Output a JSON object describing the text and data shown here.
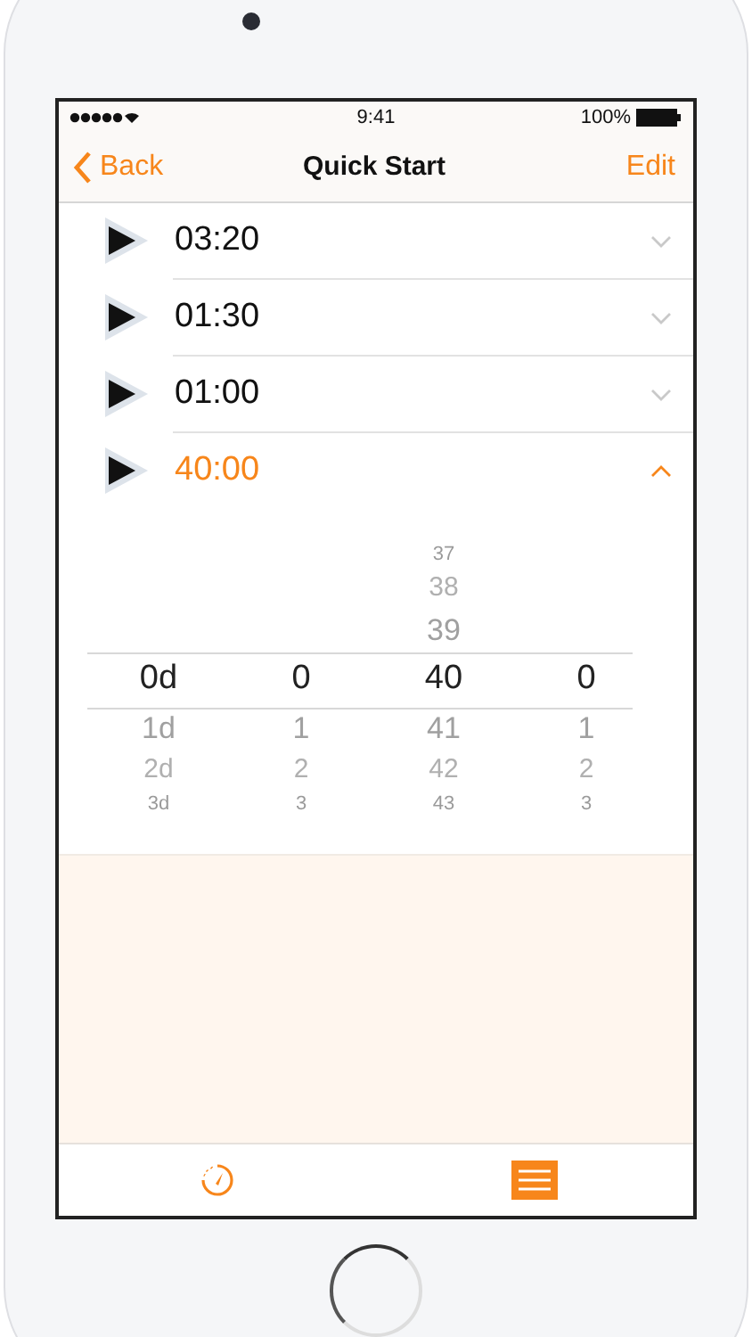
{
  "status_bar": {
    "time": "9:41",
    "battery": "100%"
  },
  "nav_bar": {
    "back": "Back",
    "title": "Quick Start",
    "action": "Edit"
  },
  "presets": [
    {
      "time": "03:20",
      "expanded": false
    },
    {
      "time": "01:30",
      "expanded": false
    },
    {
      "time": "01:00",
      "expanded": false
    },
    {
      "time": "40:00",
      "expanded": true
    }
  ],
  "picker": {
    "columns": [
      {
        "value": "0d",
        "below": [
          "1d",
          "2d",
          "3d"
        ]
      },
      {
        "value": "0",
        "below": [
          "1",
          "2",
          "3"
        ]
      },
      {
        "above": [
          "37",
          "38",
          "39"
        ],
        "value": "40",
        "below": [
          "41",
          "42",
          "43"
        ]
      },
      {
        "value": "0",
        "below": [
          "1",
          "2",
          "3"
        ]
      }
    ]
  },
  "tab_bar": [
    {
      "kind": "timer",
      "selected": false
    },
    {
      "kind": "list",
      "selected": true
    }
  ]
}
